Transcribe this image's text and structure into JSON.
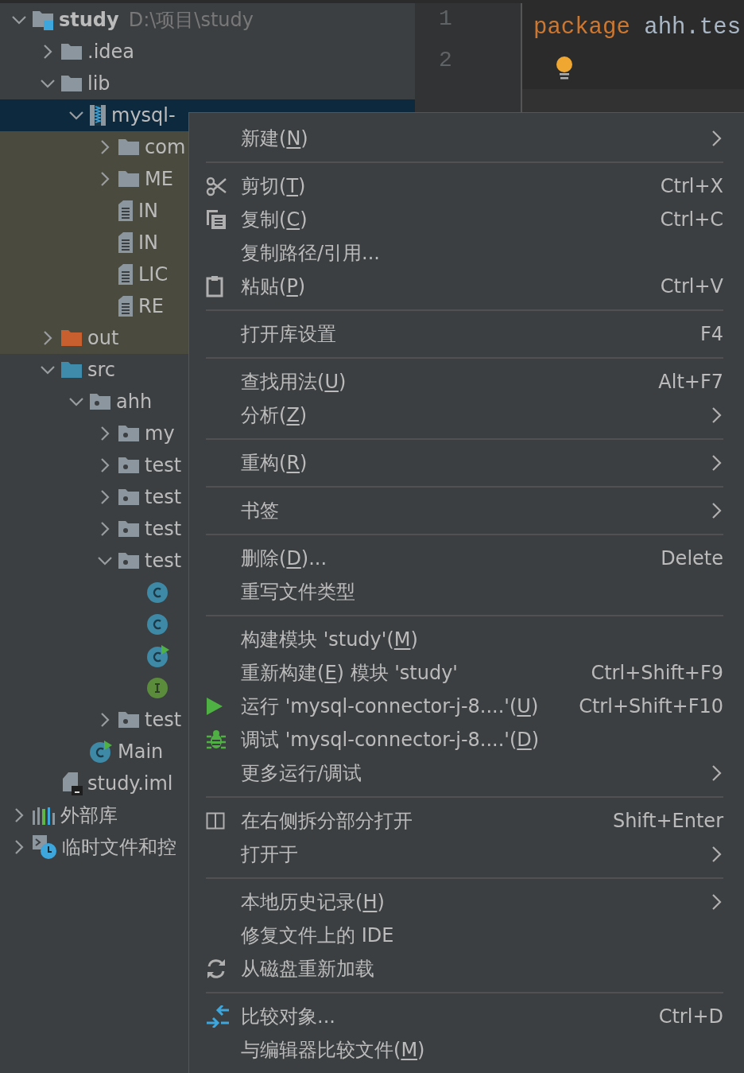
{
  "tree": [
    {
      "name": "study",
      "path": "D:\\项目\\study",
      "kind": "module",
      "expanded": true,
      "selected": false,
      "excluded": false,
      "children": [
        {
          "name": ".idea",
          "kind": "folder",
          "expanded": false,
          "selected": false,
          "excluded": false
        },
        {
          "name": "lib",
          "kind": "folder",
          "expanded": true,
          "selected": false,
          "excluded": false,
          "children": [
            {
              "name": "mysql-",
              "kind": "jar",
              "expanded": true,
              "selected": true,
              "children": [
                {
                  "name": "com",
                  "kind": "folder",
                  "expanded": false,
                  "selected": false,
                  "excluded": true
                },
                {
                  "name": "ME",
                  "kind": "folder",
                  "expanded": false,
                  "selected": false,
                  "excluded": true
                },
                {
                  "name": "IN",
                  "kind": "file",
                  "selected": false,
                  "excluded": true
                },
                {
                  "name": "IN",
                  "kind": "file",
                  "selected": false,
                  "excluded": true
                },
                {
                  "name": "LIC",
                  "kind": "file",
                  "selected": false,
                  "excluded": true
                },
                {
                  "name": "RE",
                  "kind": "file",
                  "selected": false,
                  "excluded": true
                }
              ]
            }
          ]
        },
        {
          "name": "out",
          "kind": "out-folder",
          "expanded": false,
          "selected": false,
          "excluded": true
        },
        {
          "name": "src",
          "kind": "source-folder",
          "expanded": true,
          "selected": false,
          "excluded": false,
          "children": [
            {
              "name": "ahh",
              "kind": "package",
              "expanded": true,
              "selected": false,
              "excluded": false,
              "children": [
                {
                  "name": "my",
                  "kind": "package",
                  "expanded": false,
                  "selected": false,
                  "excluded": false
                },
                {
                  "name": "test",
                  "kind": "package",
                  "expanded": false,
                  "selected": false,
                  "excluded": false
                },
                {
                  "name": "test",
                  "kind": "package",
                  "expanded": false,
                  "selected": false,
                  "excluded": false
                },
                {
                  "name": "test",
                  "kind": "package",
                  "expanded": false,
                  "selected": false,
                  "excluded": false
                },
                {
                  "name": "test",
                  "kind": "package",
                  "expanded": true,
                  "selected": false,
                  "excluded": false,
                  "children": [
                    {
                      "kind": "class",
                      "selected": false,
                      "excluded": false
                    },
                    {
                      "kind": "class",
                      "selected": false,
                      "excluded": false
                    },
                    {
                      "kind": "runnable-class",
                      "selected": false,
                      "excluded": false
                    },
                    {
                      "kind": "interface",
                      "selected": false,
                      "excluded": false
                    }
                  ]
                },
                {
                  "name": "test",
                  "kind": "package",
                  "expanded": false,
                  "selected": false,
                  "excluded": false
                }
              ]
            },
            {
              "name": "Main",
              "kind": "runnable-class",
              "selected": false,
              "excluded": false
            }
          ]
        },
        {
          "name": "study.iml",
          "kind": "iml",
          "selected": false,
          "excluded": false
        }
      ]
    },
    {
      "name": "外部库",
      "kind": "libraries",
      "expanded": false,
      "selected": false,
      "excluded": false
    },
    {
      "name": "临时文件和控",
      "kind": "scratches",
      "expanded": false,
      "selected": false,
      "excluded": false
    }
  ],
  "editor": {
    "lines": [
      {
        "number": "1",
        "code": [
          {
            "kind": "keyword",
            "text": "package"
          },
          {
            "kind": "plain",
            "text": " ahh.tes"
          }
        ]
      },
      {
        "number": "2",
        "hint": true
      }
    ]
  },
  "context_menu": [
    [
      {
        "label": "新建(",
        "mnemonic": "N",
        "label_end": ")",
        "submenu": true
      }
    ],
    [
      {
        "kind": "scissors",
        "label": "剪切(",
        "mnemonic": "T",
        "label_end": ")",
        "shortcut": "Ctrl+X",
        "submenu": false
      },
      {
        "kind": "copy",
        "label": "复制(",
        "mnemonic": "C",
        "label_end": ")",
        "shortcut": "Ctrl+C",
        "submenu": false
      },
      {
        "label": "复制路径/引用...",
        "submenu": false
      },
      {
        "kind": "paste",
        "label": "粘贴(",
        "mnemonic": "P",
        "label_end": ")",
        "shortcut": "Ctrl+V",
        "submenu": false
      }
    ],
    [
      {
        "label": "打开库设置",
        "shortcut": "F4",
        "submenu": false
      }
    ],
    [
      {
        "label": "查找用法(",
        "mnemonic": "U",
        "label_end": ")",
        "shortcut": "Alt+F7",
        "submenu": false
      },
      {
        "label": "分析(",
        "mnemonic": "Z",
        "label_end": ")",
        "submenu": true
      }
    ],
    [
      {
        "label": "重构(",
        "mnemonic": "R",
        "label_end": ")",
        "submenu": true
      }
    ],
    [
      {
        "label": "书签",
        "submenu": true
      }
    ],
    [
      {
        "label": "删除(",
        "mnemonic": "D",
        "label_end": ")...",
        "shortcut": "Delete",
        "submenu": false
      },
      {
        "label": "重写文件类型",
        "submenu": false
      }
    ],
    [
      {
        "label": "构建模块 'study'(",
        "mnemonic": "M",
        "label_end": ")",
        "submenu": false
      },
      {
        "label": "重新构建(",
        "mnemonic": "E",
        "label_end": ") 模块 'study'",
        "shortcut": "Ctrl+Shift+F9",
        "submenu": false
      },
      {
        "kind": "run",
        "label": "运行 'mysql-connector-j-8....'(",
        "mnemonic": "U",
        "label_end": ")",
        "shortcut": "Ctrl+Shift+F10",
        "submenu": false
      },
      {
        "kind": "debug",
        "label": "调试 'mysql-connector-j-8....'(",
        "mnemonic": "D",
        "label_end": ")",
        "submenu": false
      },
      {
        "label": "更多运行/调试",
        "submenu": true
      }
    ],
    [
      {
        "kind": "split",
        "label": "在右侧拆分部分打开",
        "shortcut": "Shift+Enter",
        "submenu": false
      },
      {
        "label": "打开于",
        "submenu": true
      }
    ],
    [
      {
        "label": "本地历史记录(",
        "mnemonic": "H",
        "label_end": ")",
        "submenu": true
      },
      {
        "label": "修复文件上的 IDE",
        "submenu": false
      },
      {
        "kind": "reload",
        "label": "从磁盘重新加载",
        "submenu": false
      }
    ],
    [
      {
        "kind": "compare",
        "label": "比较对象...",
        "shortcut": "Ctrl+D",
        "submenu": false
      },
      {
        "label": "与编辑器比较文件(",
        "mnemonic": "M",
        "label_end": ")",
        "submenu": false
      }
    ]
  ]
}
